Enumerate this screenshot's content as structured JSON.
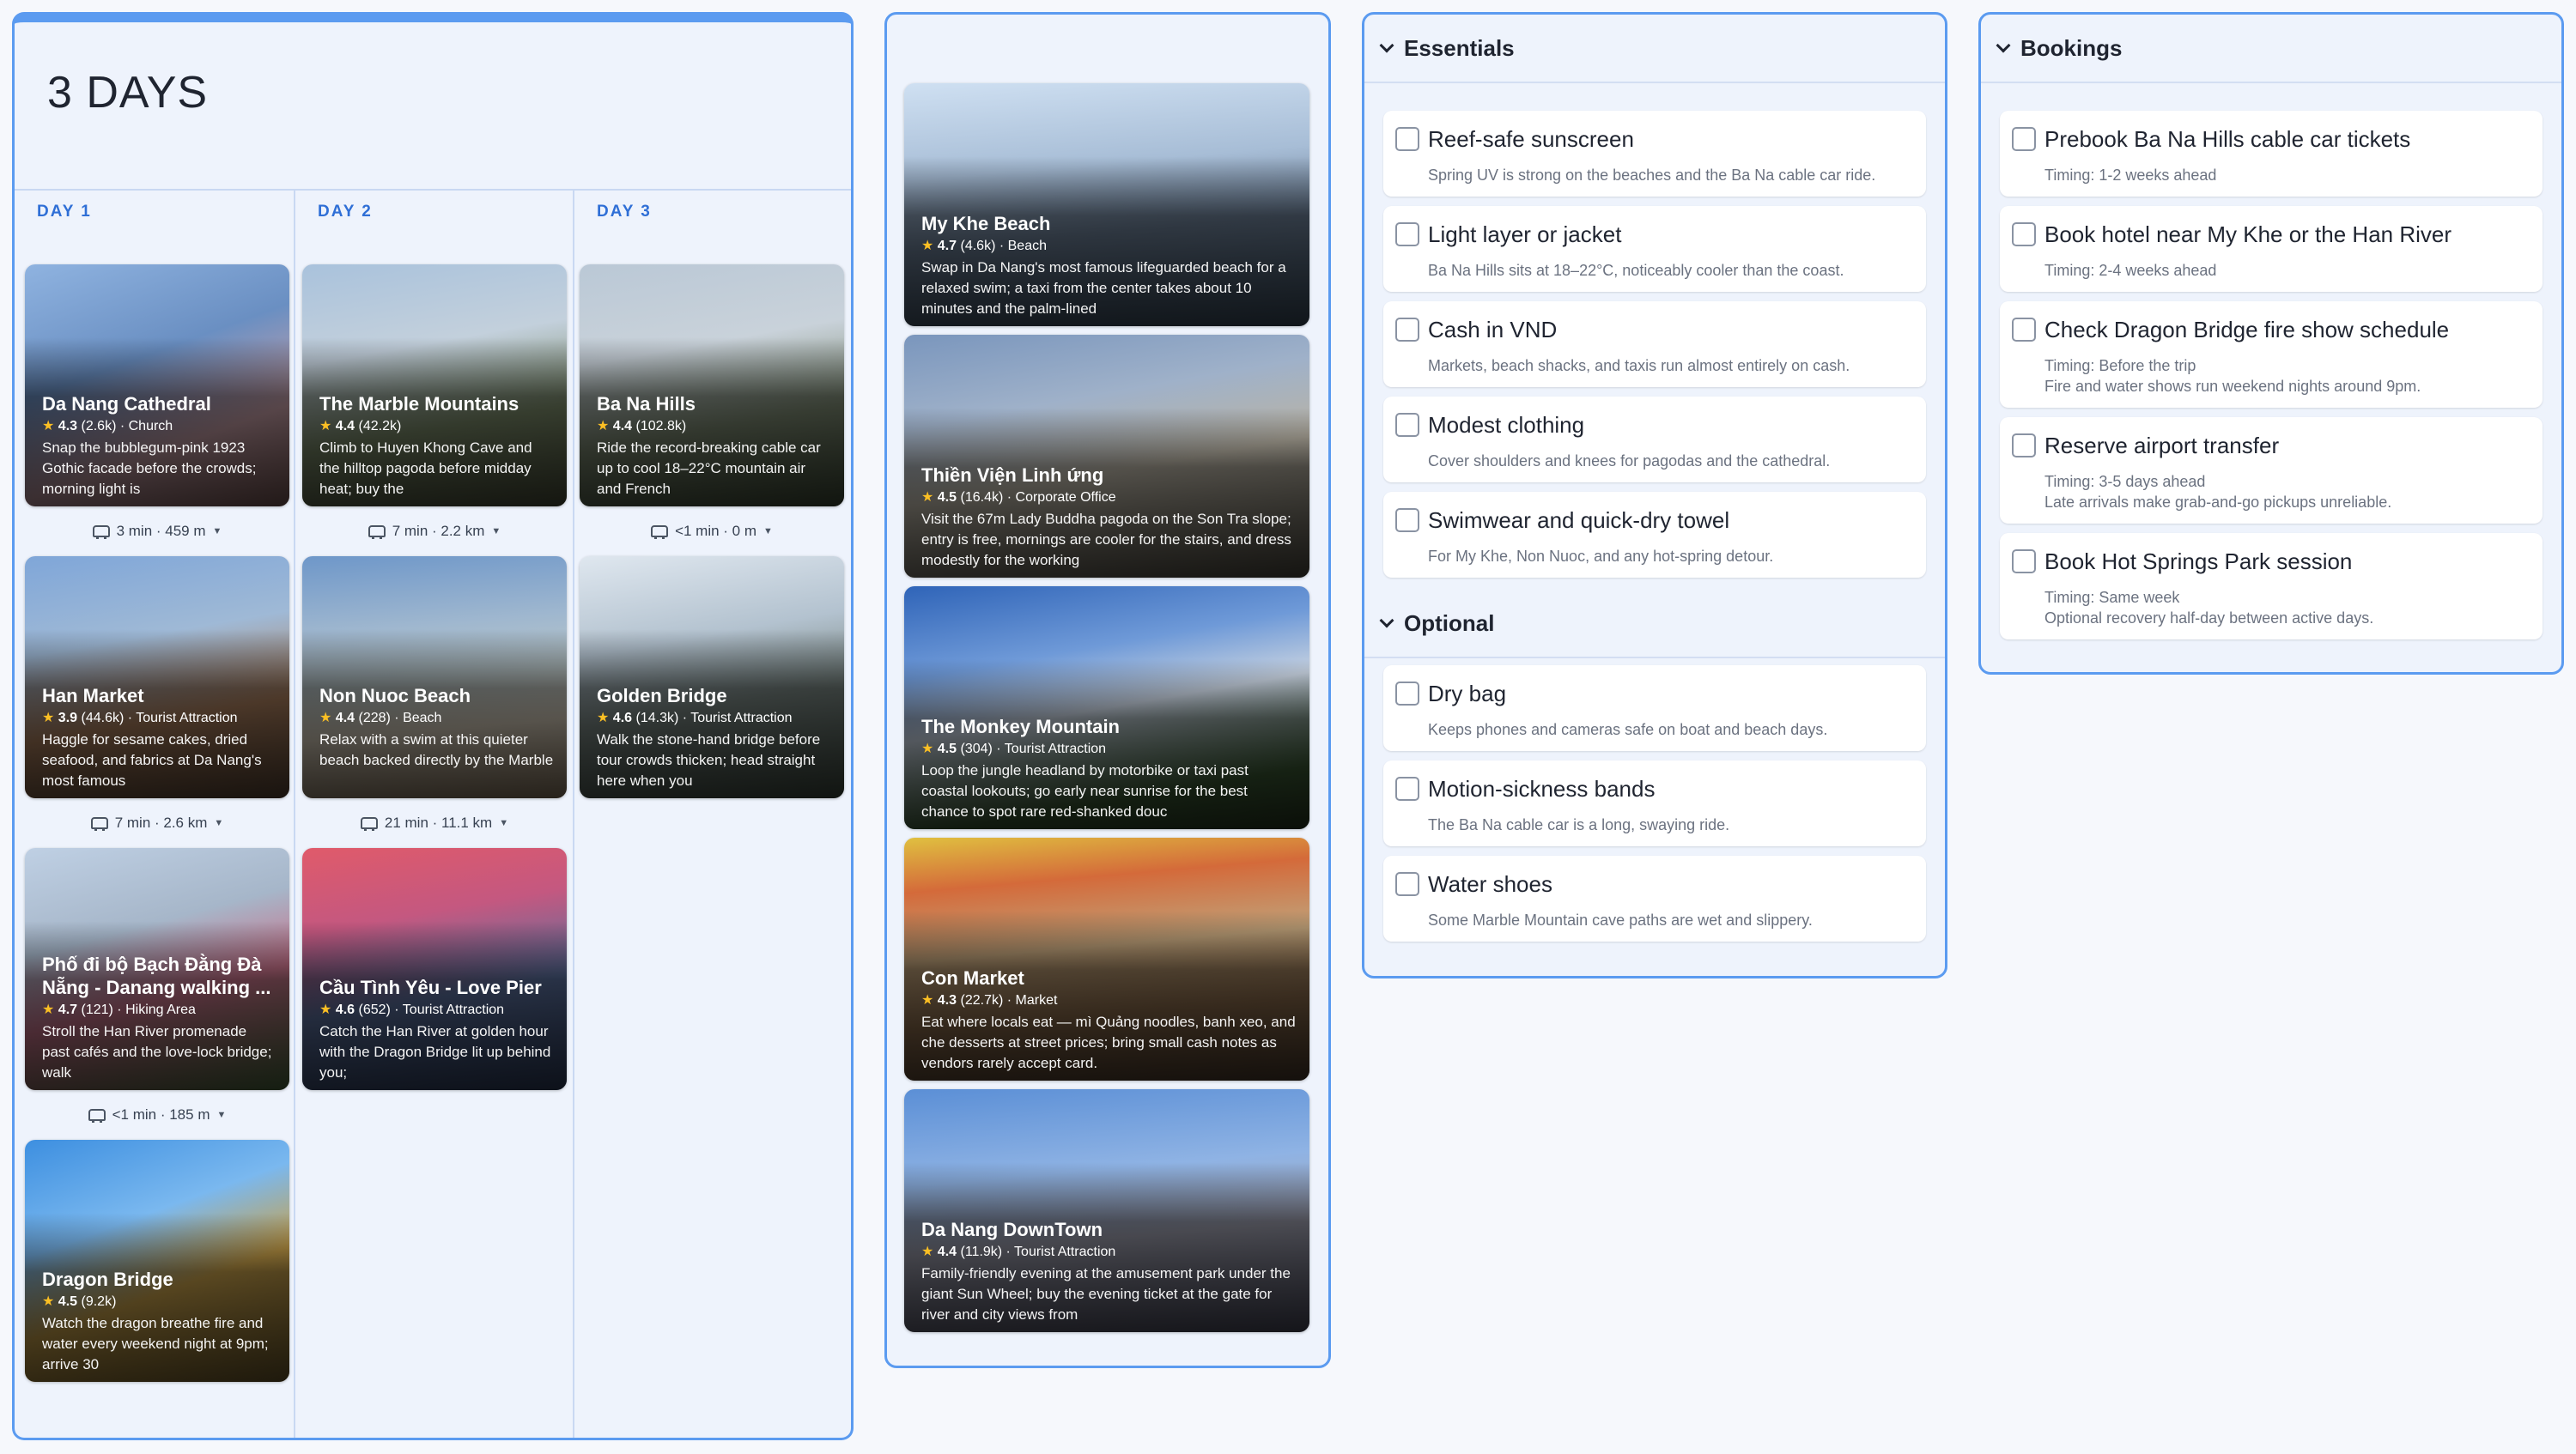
{
  "itinerary": {
    "title": "3 DAYS",
    "days": [
      {
        "label": "DAY 1",
        "places": [
          {
            "name": "Da Nang Cathedral",
            "rating": "4.3",
            "reviews": "(2.6k)",
            "category": "Church",
            "desc": "Snap the bubblegum-pink 1923 Gothic facade before the crowds; morning light is"
          },
          {
            "name": "Han Market",
            "rating": "3.9",
            "reviews": "(44.6k)",
            "category": "Tourist Attraction",
            "desc": "Haggle for sesame cakes, dried seafood, and fabrics at Da Nang's most famous"
          },
          {
            "name": "Phố đi bộ Bạch Đằng Đà Nẵng - Danang walking ...",
            "rating": "4.7",
            "reviews": "(121)",
            "category": "Hiking Area",
            "desc": "Stroll the Han River promenade past cafés and the love-lock bridge; walk"
          },
          {
            "name": "Dragon Bridge",
            "rating": "4.5",
            "reviews": "(9.2k)",
            "category": "",
            "desc": "Watch the dragon breathe fire and water every weekend night at 9pm; arrive 30"
          }
        ],
        "travel": [
          "3 min · 459 m",
          "7 min · 2.6 km",
          "<1 min · 185 m"
        ]
      },
      {
        "label": "DAY 2",
        "places": [
          {
            "name": "The Marble Mountains",
            "rating": "4.4",
            "reviews": "(42.2k)",
            "category": "",
            "desc": "Climb to Huyen Khong Cave and the hilltop pagoda before midday heat; buy the"
          },
          {
            "name": "Non Nuoc Beach",
            "rating": "4.4",
            "reviews": "(228)",
            "category": "Beach",
            "desc": "Relax with a swim at this quieter beach backed directly by the Marble"
          },
          {
            "name": "Cầu Tình Yêu - Love Pier",
            "rating": "4.6",
            "reviews": "(652)",
            "category": "Tourist Attraction",
            "desc": "Catch the Han River at golden hour with the Dragon Bridge lit up behind you;"
          }
        ],
        "travel": [
          "7 min · 2.2 km",
          "21 min · 11.1 km"
        ]
      },
      {
        "label": "DAY 3",
        "places": [
          {
            "name": "Ba Na Hills",
            "rating": "4.4",
            "reviews": "(102.8k)",
            "category": "",
            "desc": "Ride the record-breaking cable car up to cool 18–22°C mountain air and French"
          },
          {
            "name": "Golden Bridge",
            "rating": "4.6",
            "reviews": "(14.3k)",
            "category": "Tourist Attraction",
            "desc": "Walk the stone-hand bridge before tour crowds thicken; head straight here when you"
          }
        ],
        "travel": [
          "<1 min · 0 m"
        ]
      }
    ]
  },
  "places": [
    {
      "name": "My Khe Beach",
      "rating": "4.7",
      "reviews": "(4.6k)",
      "category": "Beach",
      "desc": "Swap in Da Nang's most famous lifeguarded beach for a relaxed swim; a taxi from the center takes about 10 minutes and the palm-lined"
    },
    {
      "name": "Thiền Viện Linh ứng",
      "rating": "4.5",
      "reviews": "(16.4k)",
      "category": "Corporate Office",
      "desc": "Visit the 67m Lady Buddha pagoda on the Son Tra slope; entry is free, mornings are cooler for the stairs, and dress modestly for the working"
    },
    {
      "name": "The Monkey Mountain",
      "rating": "4.5",
      "reviews": "(304)",
      "category": "Tourist Attraction",
      "desc": "Loop the jungle headland by motorbike or taxi past coastal lookouts; go early near sunrise for the best chance to spot rare red-shanked douc"
    },
    {
      "name": "Con Market",
      "rating": "4.3",
      "reviews": "(22.7k)",
      "category": "Market",
      "desc": "Eat where locals eat — mì Quảng noodles, banh xeo, and che desserts at street prices; bring small cash notes as vendors rarely accept card."
    },
    {
      "name": "Da Nang DownTown",
      "rating": "4.4",
      "reviews": "(11.9k)",
      "category": "Tourist Attraction",
      "desc": "Family-friendly evening at the amusement park under the giant Sun Wheel; buy the evening ticket at the gate for river and city views from"
    }
  ],
  "essentials": {
    "title": "Essentials",
    "items": [
      {
        "title": "Reef-safe sunscreen",
        "note": "Spring UV is strong on the beaches and the Ba Na cable car ride."
      },
      {
        "title": "Light layer or jacket",
        "note": "Ba Na Hills sits at 18–22°C, noticeably cooler than the coast."
      },
      {
        "title": "Cash in VND",
        "note": "Markets, beach shacks, and taxis run almost entirely on cash."
      },
      {
        "title": "Modest clothing",
        "note": "Cover shoulders and knees for pagodas and the cathedral."
      },
      {
        "title": "Swimwear and quick-dry towel",
        "note": "For My Khe, Non Nuoc, and any hot-spring detour."
      }
    ],
    "optional_title": "Optional",
    "optional_items": [
      {
        "title": "Dry bag",
        "note": "Keeps phones and cameras safe on boat and beach days."
      },
      {
        "title": "Motion-sickness bands",
        "note": "The Ba Na cable car is a long, swaying ride."
      },
      {
        "title": "Water shoes",
        "note": "Some Marble Mountain cave paths are wet and slippery."
      }
    ]
  },
  "bookings": {
    "title": "Bookings",
    "items": [
      {
        "title": "Prebook Ba Na Hills cable car tickets",
        "timing": "Timing: 1-2 weeks ahead",
        "note": ""
      },
      {
        "title": "Book hotel near My Khe or the Han River",
        "timing": "Timing: 2-4 weeks ahead",
        "note": ""
      },
      {
        "title": "Check Dragon Bridge fire show schedule",
        "timing": "Timing: Before the trip",
        "note": "Fire and water shows run weekend nights around 9pm."
      },
      {
        "title": "Reserve airport transfer",
        "timing": "Timing: 3-5 days ahead",
        "note": "Late arrivals make grab-and-go pickups unreliable."
      },
      {
        "title": "Book Hot Springs Park session",
        "timing": "Timing: Same week",
        "note": "Optional recovery half-day between active days."
      }
    ]
  },
  "colors": {
    "accent": "#5b9bf0",
    "day_label": "#2f6fd6",
    "star": "#fbbf24",
    "panel_bg": "#eef3fc"
  }
}
